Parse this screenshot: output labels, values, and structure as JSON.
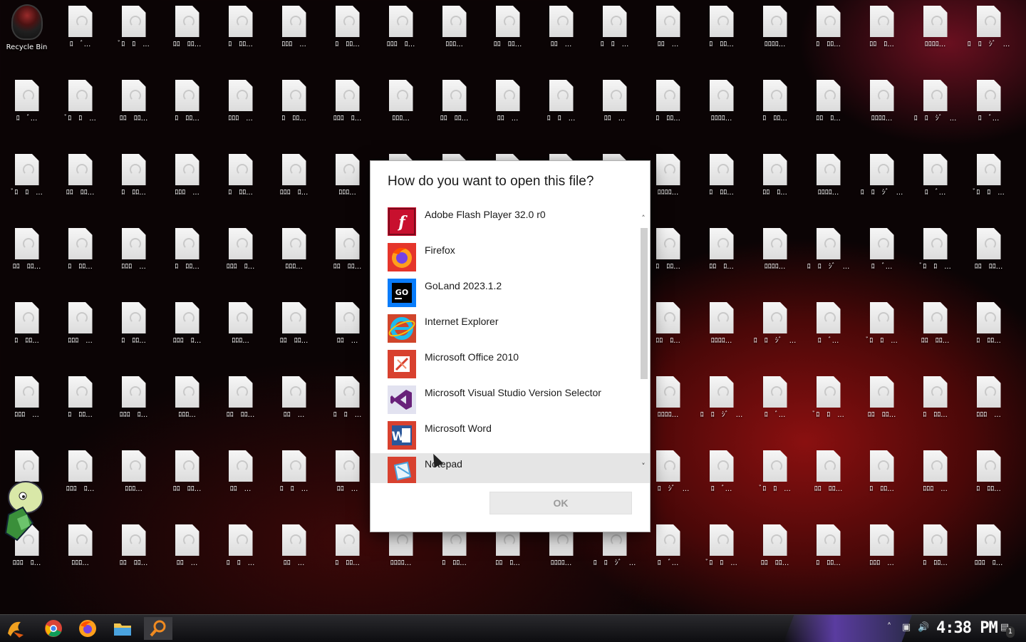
{
  "desktop": {
    "recycle_bin": "Recycle Bin",
    "file_labels": [
      [
        "ﾛ　ﾛ　ｼﾞ　...",
        "ﾛ　ﾞ...",
        "ﾞﾛ　ﾛ　...",
        "ﾛﾛ　ﾛﾛ...",
        "ﾛ　ﾛﾛ...",
        "ﾛﾛﾛ　...",
        "ﾛ　ﾛﾛ...",
        "ﾛﾛﾛ　ﾛ...",
        "ﾛﾛﾛ...",
        "ﾛﾛ　ﾛﾛ...",
        "ﾛﾛ　...",
        "ﾛ　ﾛ　...",
        "ﾛﾛ　...",
        "ﾛ　ﾛﾛ...",
        "ﾛﾛﾛﾛ...",
        "ﾛ　ﾛﾛ...",
        "ﾛﾛ　ﾛ...",
        "ﾛﾛﾛﾛ..."
      ]
    ]
  },
  "dialog": {
    "title": "How do you want to open this file?",
    "apps": [
      {
        "label": "Adobe Flash Player 32.0 r0",
        "icon": "flash-icon",
        "color": "#c8102e"
      },
      {
        "label": "Firefox",
        "icon": "firefox-icon",
        "color": "#ff7139"
      },
      {
        "label": "GoLand 2023.1.2",
        "icon": "goland-icon",
        "color": "#087cfa"
      },
      {
        "label": "Internet Explorer",
        "icon": "internet-explorer-icon",
        "color": "#1ebbee"
      },
      {
        "label": "Microsoft Office 2010",
        "icon": "office-icon",
        "color": "#e63c2e"
      },
      {
        "label": "Microsoft Visual Studio Version Selector",
        "icon": "visual-studio-icon",
        "color": "#68217a"
      },
      {
        "label": "Microsoft Word",
        "icon": "word-icon",
        "color": "#2b579a"
      },
      {
        "label": "Notepad",
        "icon": "notepad-icon",
        "color": "#4aa3df"
      }
    ],
    "ok_label": "OK"
  },
  "taskbar": {
    "time": "4:38 PM",
    "notification_count": "1"
  }
}
